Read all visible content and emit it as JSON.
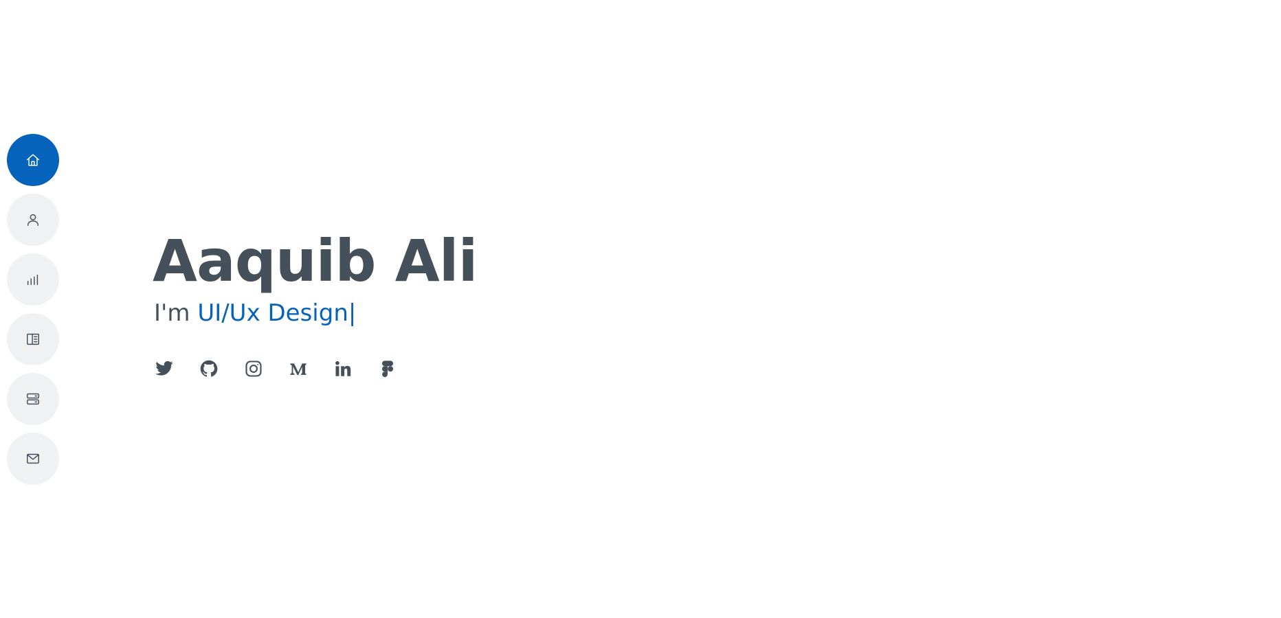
{
  "nav": {
    "items": [
      {
        "icon": "house-icon",
        "active": true
      },
      {
        "icon": "person-icon",
        "active": false
      },
      {
        "icon": "bar-chart-icon",
        "active": false
      },
      {
        "icon": "book-icon",
        "active": false
      },
      {
        "icon": "server-icon",
        "active": false
      },
      {
        "icon": "envelope-icon",
        "active": false
      }
    ]
  },
  "hero": {
    "name": "Aaquib Ali",
    "tagline_prefix": "I'm",
    "typed_text": "UI/Ux Design|"
  },
  "socials": [
    {
      "icon": "twitter-icon"
    },
    {
      "icon": "github-icon"
    },
    {
      "icon": "instagram-icon"
    },
    {
      "icon": "medium-icon"
    },
    {
      "icon": "linkedin-icon"
    },
    {
      "icon": "figma-icon"
    }
  ],
  "colors": {
    "accent": "#0563bb",
    "text": "#45505b",
    "nav_bg": "#f0f1f3",
    "background": "#ffffff"
  }
}
